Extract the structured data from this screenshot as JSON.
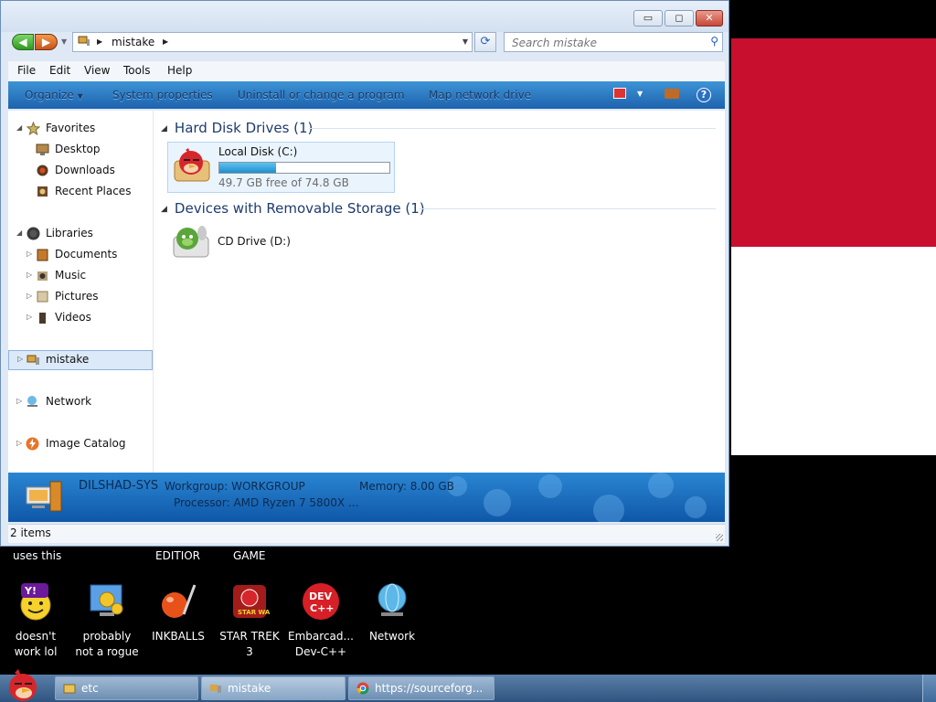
{
  "window": {
    "controls": {
      "minimize": "▭",
      "maximize": "◻",
      "close": "✕"
    },
    "nav": {
      "back": "◀",
      "forward": "▶"
    },
    "address": {
      "crumb": "mistake"
    },
    "search": {
      "placeholder": "Search mistake"
    },
    "menu": [
      "File",
      "Edit",
      "View",
      "Tools",
      "Help"
    ],
    "toolbar": {
      "organize": "Organize",
      "system_properties": "System properties",
      "uninstall": "Uninstall or change a program",
      "map_drive": "Map network drive",
      "help": "?"
    },
    "navpane": {
      "favorites": "Favorites",
      "desktop": "Desktop",
      "downloads": "Downloads",
      "recent_places": "Recent Places",
      "libraries": "Libraries",
      "documents": "Documents",
      "music": "Music",
      "pictures": "Pictures",
      "videos": "Videos",
      "computer": "mistake",
      "network": "Network",
      "image_catalog": "Image Catalog"
    },
    "content": {
      "group_hdd": "Hard Disk Drives (1)",
      "group_removable": "Devices with Removable Storage (1)",
      "drive_c": {
        "name": "Local Disk (C:)",
        "free_text": "49.7 GB free of 74.8 GB",
        "used_fraction": 0.336
      },
      "drive_d": {
        "name": "CD Drive (D:)"
      }
    },
    "details": {
      "computer_name": "DILSHAD-SYS",
      "workgroup": "Workgroup: WORKGROUP",
      "memory": "Memory: 8.00 GB",
      "processor": "Processor: AMD Ryzen 7 5800X ..."
    },
    "status": "2 items"
  },
  "desktop": {
    "labels": {
      "uses_this": "uses this",
      "editior": "EDITIOR",
      "game": "GAME"
    },
    "icons": [
      {
        "line1": "doesn't",
        "line2": "work lol"
      },
      {
        "line1": "probably",
        "line2": "not a rogue"
      },
      {
        "line1": "INKBALLS",
        "line2": ""
      },
      {
        "line1": "STAR TREK",
        "line2": "3"
      },
      {
        "line1": "Embarcad...",
        "line2": "Dev-C++"
      },
      {
        "line1": "Network",
        "line2": ""
      }
    ]
  },
  "taskbar": {
    "tasks": [
      {
        "label": "etc"
      },
      {
        "label": "mistake"
      },
      {
        "label": "https://sourceforg..."
      }
    ]
  },
  "colors": {
    "toolbar": "#1d62ad",
    "flag_red": "#c8102e",
    "drive_fill": "#1f8fcc"
  }
}
